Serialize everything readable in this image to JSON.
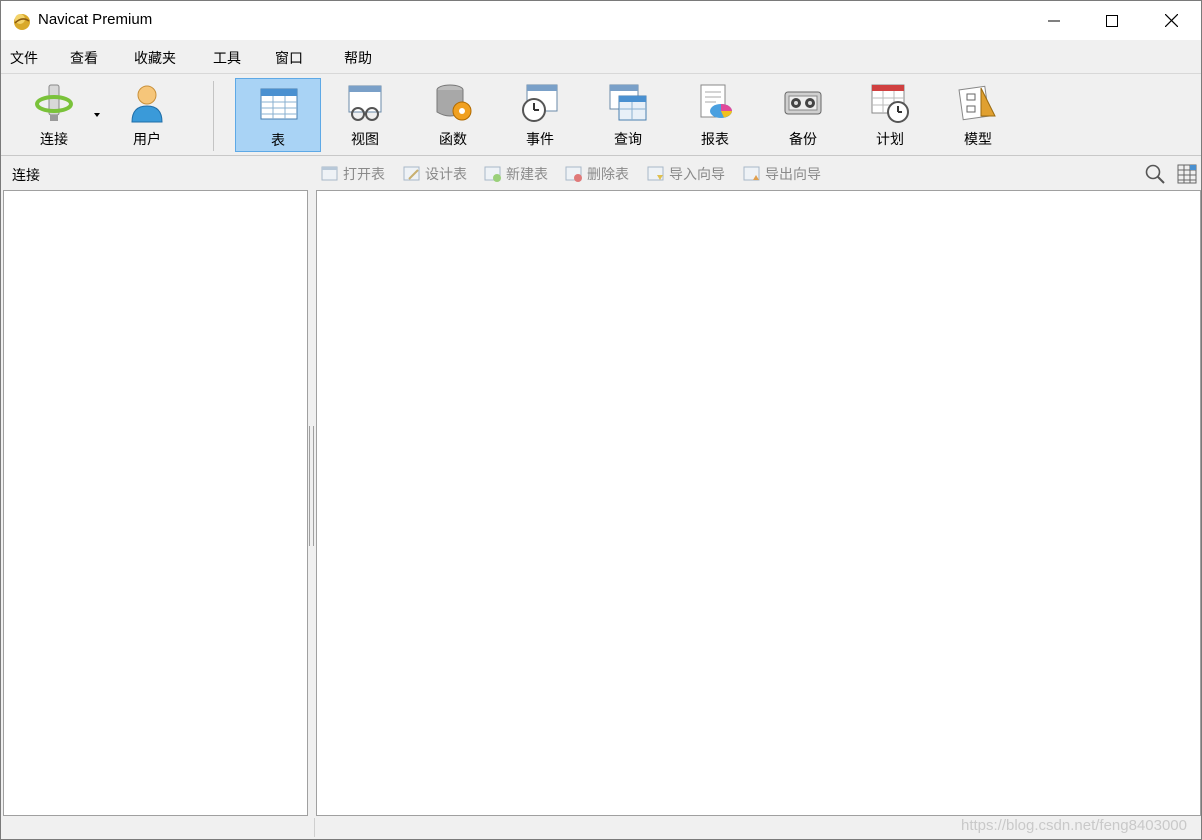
{
  "window": {
    "title": "Navicat Premium"
  },
  "menu": [
    "文件",
    "查看",
    "收藏夹",
    "工具",
    "窗口",
    "帮助"
  ],
  "toolbar": {
    "connect": "连接",
    "user": "用户",
    "table": "表",
    "view": "视图",
    "function": "函数",
    "event": "事件",
    "query": "查询",
    "report": "报表",
    "backup": "备份",
    "schedule": "计划",
    "model": "模型",
    "active": "表"
  },
  "subbar": {
    "connection_label": "连接",
    "actions": [
      "打开表",
      "设计表",
      "新建表",
      "删除表",
      "导入向导",
      "导出向导"
    ]
  },
  "status": {
    "watermark": "https://blog.csdn.net/feng8403000"
  },
  "colors": {
    "accent": "#a9d3f5",
    "accent_border": "#5ea9e6",
    "disabled_text": "#8a8a8a"
  }
}
